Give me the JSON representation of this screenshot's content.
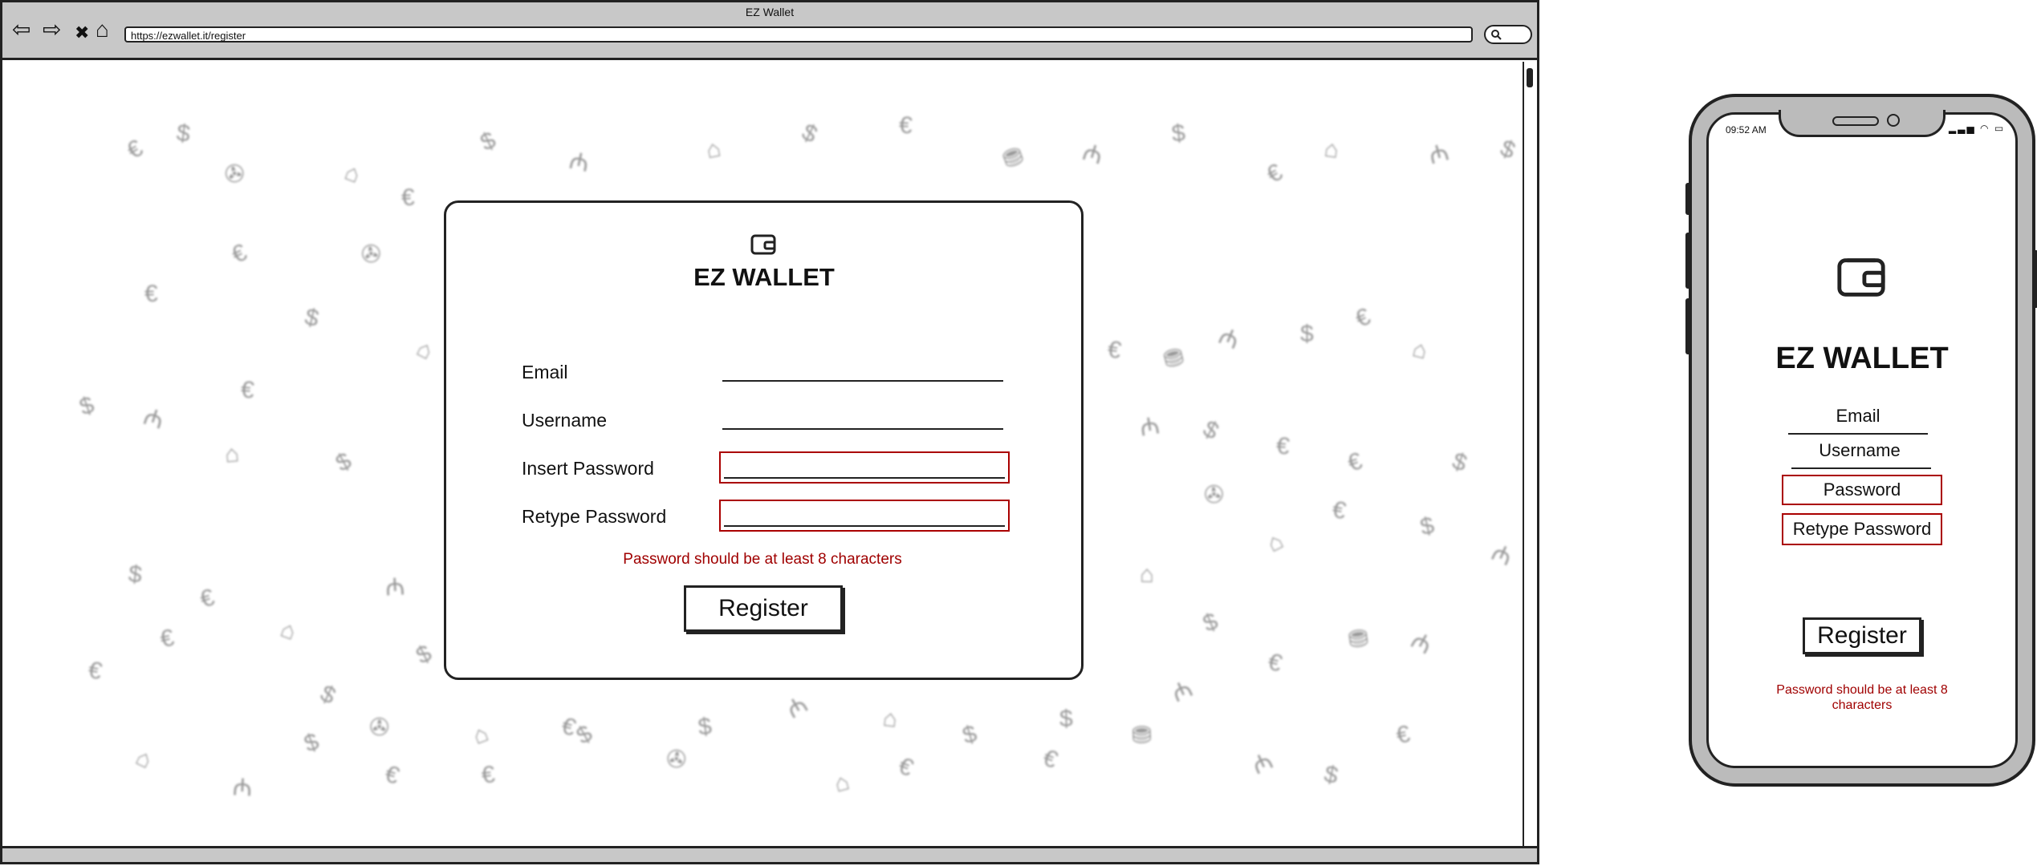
{
  "browser": {
    "title": "EZ Wallet",
    "url": "https://ezwallet.it/register",
    "nav": {
      "back": "⇦",
      "forward": "⇨",
      "stop": "✖",
      "home": "⌂"
    }
  },
  "background_icons": [
    "€",
    "$",
    "✇",
    "⌂",
    "€",
    "$",
    "₼",
    "⌂",
    "$",
    "€",
    "⛃",
    "₼",
    "$",
    "€",
    "⌂",
    "₼",
    "$",
    "€"
  ],
  "card": {
    "brand": "EZ WALLET",
    "fields": [
      {
        "label": "Email",
        "error": false
      },
      {
        "label": "Username",
        "error": false
      },
      {
        "label": "Insert Password",
        "error": true
      },
      {
        "label": "Retype Password",
        "error": true
      }
    ],
    "error_message": "Password should be at least 8 characters",
    "register_label": "Register"
  },
  "phone": {
    "time": "09:52 AM",
    "brand": "EZ WALLET",
    "fields": [
      {
        "placeholder": "Email",
        "error": false
      },
      {
        "placeholder": "Username",
        "error": false
      },
      {
        "placeholder": "Password",
        "error": true
      },
      {
        "placeholder": "Retype Password",
        "error": true
      }
    ],
    "register_label": "Register",
    "error_message": "Password should be at least 8 characters"
  },
  "colors": {
    "error": "#a00000",
    "frame": "#222222",
    "chrome": "#c8c8c8"
  }
}
